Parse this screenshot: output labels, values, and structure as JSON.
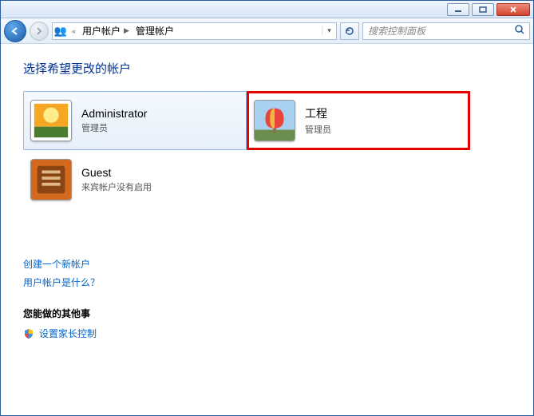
{
  "breadcrumb": {
    "seg1": "用户帐户",
    "seg2": "管理帐户"
  },
  "search": {
    "placeholder": "搜索控制面板"
  },
  "page_title": "选择希望更改的帐户",
  "accounts": [
    {
      "name": "Administrator",
      "role": "管理员"
    },
    {
      "name": "工程",
      "role": "管理员"
    },
    {
      "name": "Guest",
      "role": "来宾帐户没有启用"
    }
  ],
  "links": {
    "create": "创建一个新帐户",
    "whatis": "用户帐户是什么？"
  },
  "other_section": "您能做的其他事",
  "parental": "设置家长控制"
}
